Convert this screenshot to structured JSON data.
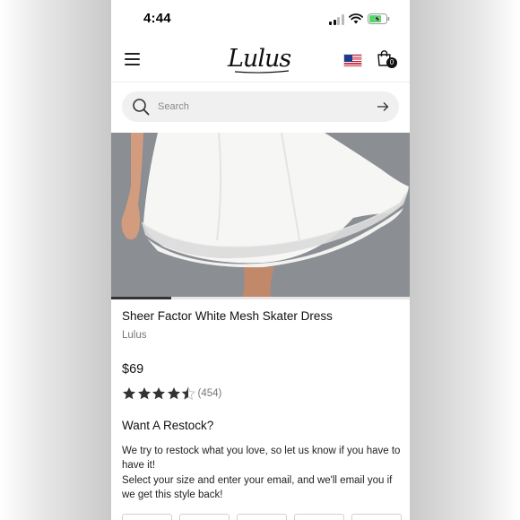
{
  "status_bar": {
    "time": "4:44",
    "battery_charging": true
  },
  "header": {
    "logo_text": "Lulus",
    "cart_count": "0",
    "country": "United States"
  },
  "search": {
    "placeholder": "Search"
  },
  "product": {
    "image_progress": 0.2,
    "title": "Sheer Factor White Mesh Skater Dress",
    "brand": "Lulus",
    "price": "$69",
    "rating": 4.5,
    "review_count": "(454)"
  },
  "restock": {
    "heading": "Want A Restock?",
    "line1": "We try to restock what you love, so let us know if you have to have it!",
    "line2": "Select your size and enter your email, and we'll email you if we get this style back!"
  },
  "colors": {
    "accent": "#111111",
    "star": "#333333",
    "image_bg": "#8b8e93"
  }
}
